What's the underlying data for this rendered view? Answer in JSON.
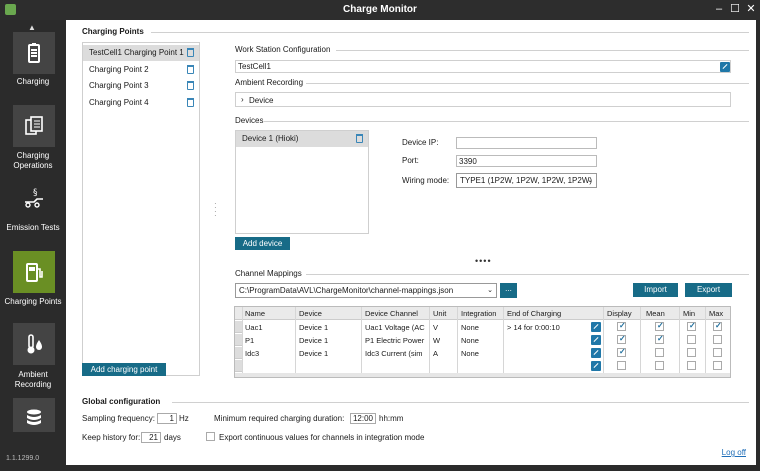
{
  "window": {
    "title": "Charge Monitor",
    "version": "1.1.1299.0"
  },
  "sidebar": {
    "items": [
      {
        "label": "Charging",
        "icon": "battery-icon"
      },
      {
        "label": "Charging Operations",
        "icon": "document-stack-icon"
      },
      {
        "label": "Emission Tests",
        "icon": "emission-icon"
      },
      {
        "label": "Charging Points",
        "icon": "charging-station-icon",
        "active": true
      },
      {
        "label": "Ambient Recording",
        "icon": "thermometer-drop-icon"
      },
      {
        "label": "",
        "icon": "database-icon"
      }
    ]
  },
  "charging_points": {
    "title": "Charging Points",
    "items": [
      "TestCell1 Charging Point 1",
      "Charging Point 2",
      "Charging Point 3",
      "Charging Point 4"
    ],
    "add_button": "Add charging point"
  },
  "work_station": {
    "title": "Work Station Configuration",
    "value": "TestCell1"
  },
  "ambient": {
    "title": "Ambient Recording",
    "device_label": "Device"
  },
  "devices": {
    "title": "Devices",
    "items": [
      "Device 1  (Hioki)"
    ],
    "add_button": "Add device",
    "ip_label": "Device IP:",
    "ip_value": "",
    "port_label": "Port:",
    "port_value": "3390",
    "wiring_label": "Wiring mode:",
    "wiring_value": "TYPE1 (1P2W, 1P2W, 1P2W, 1P2W)"
  },
  "channel_mappings": {
    "title": "Channel Mappings",
    "path": "C:\\ProgramData\\AVL\\ChargeMonitor\\channel-mappings.json",
    "browse_label": "...",
    "import_label": "Import",
    "export_label": "Export",
    "columns": [
      "Name",
      "Device",
      "Device Channel",
      "Unit",
      "Integration",
      "End of Charging",
      "Display",
      "Mean",
      "Min",
      "Max"
    ],
    "rows": [
      {
        "name": "Uac1",
        "device": "Device 1",
        "channel": "Uac1 Voltage (AC",
        "unit": "V",
        "integration": "None",
        "end": "> 14 for 0:00:10",
        "display": true,
        "mean": true,
        "min": true,
        "max": true
      },
      {
        "name": "P1",
        "device": "Device 1",
        "channel": "P1 Electric Power",
        "unit": "W",
        "integration": "None",
        "end": "",
        "display": true,
        "mean": true,
        "min": false,
        "max": false
      },
      {
        "name": "Idc3",
        "device": "Device 1",
        "channel": "Idc3 Current (sim",
        "unit": "A",
        "integration": "None",
        "end": "",
        "display": true,
        "mean": false,
        "min": false,
        "max": false
      },
      {
        "name": "",
        "device": "",
        "channel": "",
        "unit": "",
        "integration": "",
        "end": "",
        "display": false,
        "mean": false,
        "min": false,
        "max": false
      }
    ]
  },
  "global": {
    "title": "Global configuration",
    "sampling_label": "Sampling frequency:",
    "sampling_value": "1",
    "sampling_unit": "Hz",
    "min_duration_label": "Minimum required charging duration:",
    "min_duration_value": "12:00",
    "min_duration_unit": "hh:mm",
    "history_label": "Keep history for:",
    "history_value": "21",
    "history_unit": "days",
    "export_label": "Export continuous values for channels in integration mode"
  },
  "logoff": "Log off"
}
